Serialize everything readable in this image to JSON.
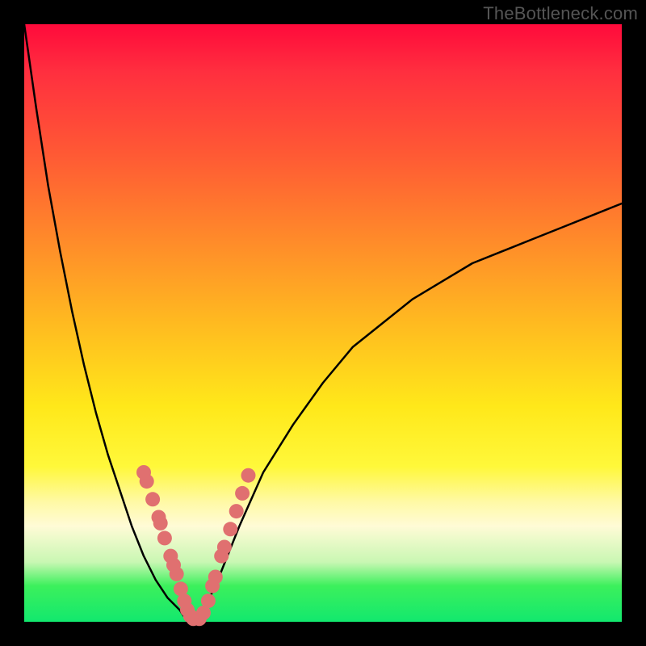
{
  "watermark": "TheBottleneck.com",
  "colors": {
    "frame": "#000000",
    "curve_stroke": "#000000",
    "dot_fill": "#e07070",
    "gradient_stops": [
      "#ff0a3b",
      "#ff2f3f",
      "#ff5a34",
      "#ff8a2a",
      "#ffba20",
      "#ffe81a",
      "#fff83a",
      "#fff9a6",
      "#fffbd6",
      "#c9f7b3",
      "#3cf05c",
      "#12e86e"
    ]
  },
  "chart_data": {
    "type": "line",
    "title": "",
    "xlabel": "",
    "ylabel": "",
    "x": [
      0.0,
      0.02,
      0.04,
      0.06,
      0.08,
      0.1,
      0.12,
      0.14,
      0.16,
      0.18,
      0.2,
      0.22,
      0.24,
      0.26,
      0.27,
      0.28,
      0.29,
      0.3,
      0.32,
      0.34,
      0.36,
      0.4,
      0.45,
      0.5,
      0.55,
      0.6,
      0.65,
      0.7,
      0.75,
      0.8,
      0.85,
      0.9,
      0.95,
      1.0
    ],
    "y": [
      1.0,
      0.86,
      0.73,
      0.62,
      0.52,
      0.43,
      0.35,
      0.28,
      0.22,
      0.16,
      0.11,
      0.07,
      0.04,
      0.02,
      0.005,
      0.0,
      0.005,
      0.02,
      0.06,
      0.11,
      0.16,
      0.25,
      0.33,
      0.4,
      0.46,
      0.5,
      0.54,
      0.57,
      0.6,
      0.62,
      0.64,
      0.66,
      0.68,
      0.7
    ],
    "xlim": [
      0,
      1
    ],
    "ylim": [
      0,
      1
    ],
    "series_note": "V-shaped bottleneck curve; minimum at x≈0.28, y=0",
    "markers": {
      "description": "highlighted data points (pink dots) clustered near the valley",
      "points": [
        {
          "x": 0.2,
          "y": 0.25
        },
        {
          "x": 0.205,
          "y": 0.235
        },
        {
          "x": 0.215,
          "y": 0.205
        },
        {
          "x": 0.225,
          "y": 0.175
        },
        {
          "x": 0.228,
          "y": 0.165
        },
        {
          "x": 0.235,
          "y": 0.14
        },
        {
          "x": 0.245,
          "y": 0.11
        },
        {
          "x": 0.25,
          "y": 0.095
        },
        {
          "x": 0.255,
          "y": 0.08
        },
        {
          "x": 0.262,
          "y": 0.055
        },
        {
          "x": 0.268,
          "y": 0.035
        },
        {
          "x": 0.273,
          "y": 0.02
        },
        {
          "x": 0.278,
          "y": 0.01
        },
        {
          "x": 0.283,
          "y": 0.005
        },
        {
          "x": 0.293,
          "y": 0.005
        },
        {
          "x": 0.3,
          "y": 0.015
        },
        {
          "x": 0.308,
          "y": 0.035
        },
        {
          "x": 0.315,
          "y": 0.06
        },
        {
          "x": 0.32,
          "y": 0.075
        },
        {
          "x": 0.33,
          "y": 0.11
        },
        {
          "x": 0.335,
          "y": 0.125
        },
        {
          "x": 0.345,
          "y": 0.155
        },
        {
          "x": 0.355,
          "y": 0.185
        },
        {
          "x": 0.365,
          "y": 0.215
        },
        {
          "x": 0.375,
          "y": 0.245
        }
      ]
    }
  }
}
